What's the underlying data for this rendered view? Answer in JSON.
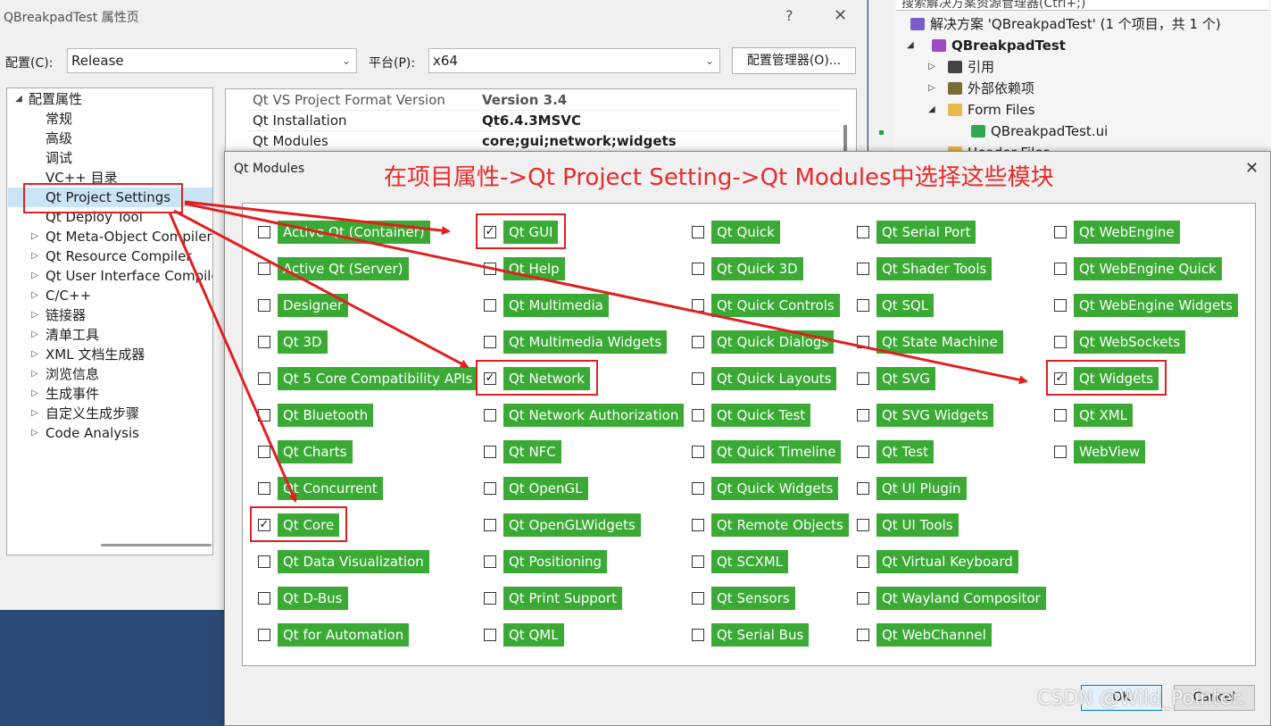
{
  "property_window": {
    "title": "QBreakpadTest 属性页",
    "help": "?",
    "close": "✕",
    "config_label": "配置(C):",
    "config_value": "Release",
    "platform_label": "平台(P):",
    "platform_value": "x64",
    "config_manager_label": "配置管理器(O)...",
    "tree": [
      {
        "label": "配置属性",
        "expander": "◢",
        "level": 0
      },
      {
        "label": "常规",
        "expander": "",
        "level": 1
      },
      {
        "label": "高级",
        "expander": "",
        "level": 1
      },
      {
        "label": "调试",
        "expander": "",
        "level": 1
      },
      {
        "label": "VC++ 目录",
        "expander": "",
        "level": 1
      },
      {
        "label": "Qt Project Settings",
        "expander": "",
        "level": 1
      },
      {
        "label": "Qt Deploy Tool",
        "expander": "",
        "level": 1
      },
      {
        "label": "Qt Meta-Object Compiler",
        "expander": "▷",
        "level": 1
      },
      {
        "label": "Qt Resource Compiler",
        "expander": "▷",
        "level": 1
      },
      {
        "label": "Qt User Interface Compiler",
        "expander": "▷",
        "level": 1
      },
      {
        "label": "C/C++",
        "expander": "▷",
        "level": 1
      },
      {
        "label": "链接器",
        "expander": "▷",
        "level": 1
      },
      {
        "label": "清单工具",
        "expander": "▷",
        "level": 1
      },
      {
        "label": "XML 文档生成器",
        "expander": "▷",
        "level": 1
      },
      {
        "label": "浏览信息",
        "expander": "▷",
        "level": 1
      },
      {
        "label": "生成事件",
        "expander": "▷",
        "level": 1
      },
      {
        "label": "自定义生成步骤",
        "expander": "▷",
        "level": 1
      },
      {
        "label": "Code Analysis",
        "expander": "▷",
        "level": 1
      }
    ],
    "grid": [
      {
        "key": "Qt VS Project Format Version",
        "value": "Version 3.4"
      },
      {
        "key": "Qt Installation",
        "value": "Qt6.4.3MSVC"
      },
      {
        "key": "Qt Modules",
        "value": "core;gui;network;widgets"
      }
    ]
  },
  "solution_explorer": {
    "search_placeholder": "搜索解决方案资源管理器(Ctrl+;)",
    "items": [
      {
        "label": "解决方案 'QBreakpadTest' (1 个项目，共 1 个)",
        "expander": "",
        "bold": false
      },
      {
        "label": "QBreakpadTest",
        "expander": "◢",
        "bold": true
      },
      {
        "label": "引用",
        "expander": "▷",
        "bold": false
      },
      {
        "label": "外部依赖项",
        "expander": "▷",
        "bold": false
      },
      {
        "label": "Form Files",
        "expander": "◢",
        "bold": false
      },
      {
        "label": "QBreakpadTest.ui",
        "expander": "",
        "bold": false
      },
      {
        "label": "Header Files",
        "expander": "",
        "bold": false
      }
    ]
  },
  "dialog": {
    "title": "Qt Modules",
    "close": "✕",
    "annotation": "在项目属性->Qt Project Setting->Qt Modules中选择这些模块",
    "ok_label": "OK",
    "cancel_label": "Cancel",
    "watermark": "CSDN @Wild_Pointer.",
    "columns": [
      [
        {
          "label": "Active Qt (Container)",
          "checked": false
        },
        {
          "label": "Active Qt (Server)",
          "checked": false
        },
        {
          "label": "Designer",
          "checked": false
        },
        {
          "label": "Qt 3D",
          "checked": false
        },
        {
          "label": "Qt 5 Core Compatibility APIs",
          "checked": false
        },
        {
          "label": "Qt Bluetooth",
          "checked": false
        },
        {
          "label": "Qt Charts",
          "checked": false
        },
        {
          "label": "Qt Concurrent",
          "checked": false
        },
        {
          "label": "Qt Core",
          "checked": true
        },
        {
          "label": "Qt Data Visualization",
          "checked": false
        },
        {
          "label": "Qt D-Bus",
          "checked": false
        },
        {
          "label": "Qt for Automation",
          "checked": false
        }
      ],
      [
        {
          "label": "Qt GUI",
          "checked": true
        },
        {
          "label": "Qt Help",
          "checked": false
        },
        {
          "label": "Qt Multimedia",
          "checked": false
        },
        {
          "label": "Qt Multimedia Widgets",
          "checked": false
        },
        {
          "label": "Qt Network",
          "checked": true
        },
        {
          "label": "Qt Network Authorization",
          "checked": false
        },
        {
          "label": "Qt NFC",
          "checked": false
        },
        {
          "label": "Qt OpenGL",
          "checked": false
        },
        {
          "label": "Qt OpenGLWidgets",
          "checked": false
        },
        {
          "label": "Qt Positioning",
          "checked": false
        },
        {
          "label": "Qt Print Support",
          "checked": false
        },
        {
          "label": "Qt QML",
          "checked": false
        }
      ],
      [
        {
          "label": "Qt Quick",
          "checked": false
        },
        {
          "label": "Qt Quick 3D",
          "checked": false
        },
        {
          "label": "Qt Quick Controls",
          "checked": false
        },
        {
          "label": "Qt Quick Dialogs",
          "checked": false
        },
        {
          "label": "Qt Quick Layouts",
          "checked": false
        },
        {
          "label": "Qt Quick Test",
          "checked": false
        },
        {
          "label": "Qt Quick Timeline",
          "checked": false
        },
        {
          "label": "Qt Quick Widgets",
          "checked": false
        },
        {
          "label": "Qt Remote Objects",
          "checked": false
        },
        {
          "label": "Qt SCXML",
          "checked": false
        },
        {
          "label": "Qt Sensors",
          "checked": false
        },
        {
          "label": "Qt Serial Bus",
          "checked": false
        }
      ],
      [
        {
          "label": "Qt Serial Port",
          "checked": false
        },
        {
          "label": "Qt Shader Tools",
          "checked": false
        },
        {
          "label": "Qt SQL",
          "checked": false
        },
        {
          "label": "Qt State Machine",
          "checked": false
        },
        {
          "label": "Qt SVG",
          "checked": false
        },
        {
          "label": "Qt SVG Widgets",
          "checked": false
        },
        {
          "label": "Qt Test",
          "checked": false
        },
        {
          "label": "Qt UI Plugin",
          "checked": false
        },
        {
          "label": "Qt UI Tools",
          "checked": false
        },
        {
          "label": "Qt Virtual Keyboard",
          "checked": false
        },
        {
          "label": "Qt Wayland Compositor",
          "checked": false
        },
        {
          "label": "Qt WebChannel",
          "checked": false
        }
      ],
      [
        {
          "label": "Qt WebEngine",
          "checked": false
        },
        {
          "label": "Qt WebEngine Quick",
          "checked": false
        },
        {
          "label": "Qt WebEngine Widgets",
          "checked": false
        },
        {
          "label": "Qt WebSockets",
          "checked": false
        },
        {
          "label": "Qt Widgets",
          "checked": true
        },
        {
          "label": "Qt XML",
          "checked": false
        },
        {
          "label": "WebView",
          "checked": false
        }
      ]
    ]
  },
  "colors": {
    "module_tag": "#3aaa35",
    "annotation": "#e82b2b",
    "selection": "#cce4f7"
  }
}
